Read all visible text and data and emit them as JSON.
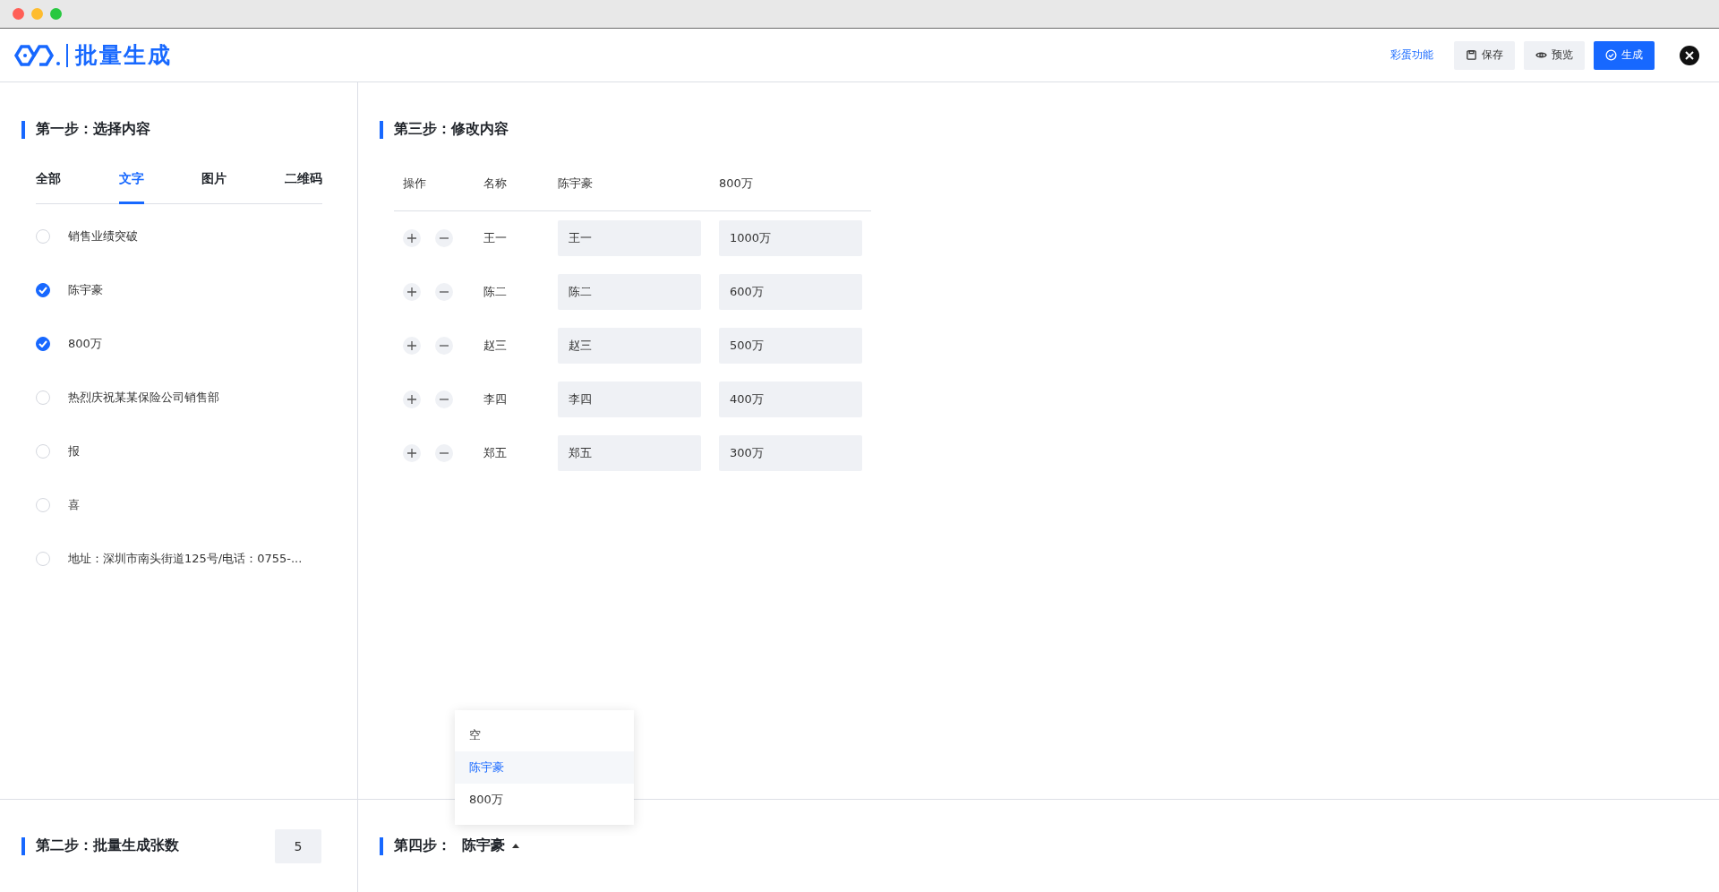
{
  "header": {
    "logo_text": "批量生成",
    "actions": [
      {
        "kind": "link",
        "label": "彩蛋功能"
      },
      {
        "kind": "secondary",
        "label": "保存"
      },
      {
        "kind": "secondary",
        "label": "预览"
      },
      {
        "kind": "primary",
        "label": "生成"
      }
    ]
  },
  "step1": {
    "title": "第一步：选择内容",
    "tabs": [
      {
        "label": "全部",
        "selected": false
      },
      {
        "label": "文字",
        "selected": true
      },
      {
        "label": "图片",
        "selected": false
      },
      {
        "label": "二维码",
        "selected": false
      }
    ],
    "items": [
      {
        "label": "销售业绩突破",
        "checked": false
      },
      {
        "label": "陈宇豪",
        "checked": true
      },
      {
        "label": "800万",
        "checked": true
      },
      {
        "label": "热烈庆祝某某保险公司销售部",
        "checked": false
      },
      {
        "label": "报",
        "checked": false
      },
      {
        "label": "喜",
        "checked": false
      },
      {
        "label": "地址：深圳市南头街道125号/电话：0755-...",
        "checked": false
      }
    ]
  },
  "step2": {
    "title": "第二步：批量生成张数",
    "count": "5"
  },
  "step3": {
    "title": "第三步：修改内容",
    "columns": [
      "操作",
      "名称",
      "陈宇豪",
      "800万"
    ],
    "rows": [
      {
        "name": "王一",
        "values": [
          "王一",
          "1000万"
        ]
      },
      {
        "name": "陈二",
        "values": [
          "陈二",
          "600万"
        ]
      },
      {
        "name": "赵三",
        "values": [
          "赵三",
          "500万"
        ]
      },
      {
        "name": "李四",
        "values": [
          "李四",
          "400万"
        ]
      },
      {
        "name": "郑五",
        "values": [
          "郑五",
          "300万"
        ]
      }
    ]
  },
  "step4": {
    "label": "第四步：",
    "value": "陈宇豪",
    "expanded": true,
    "options": [
      {
        "label": "空",
        "selected": false
      },
      {
        "label": "陈宇豪",
        "selected": true
      },
      {
        "label": "800万",
        "selected": false
      }
    ]
  }
}
